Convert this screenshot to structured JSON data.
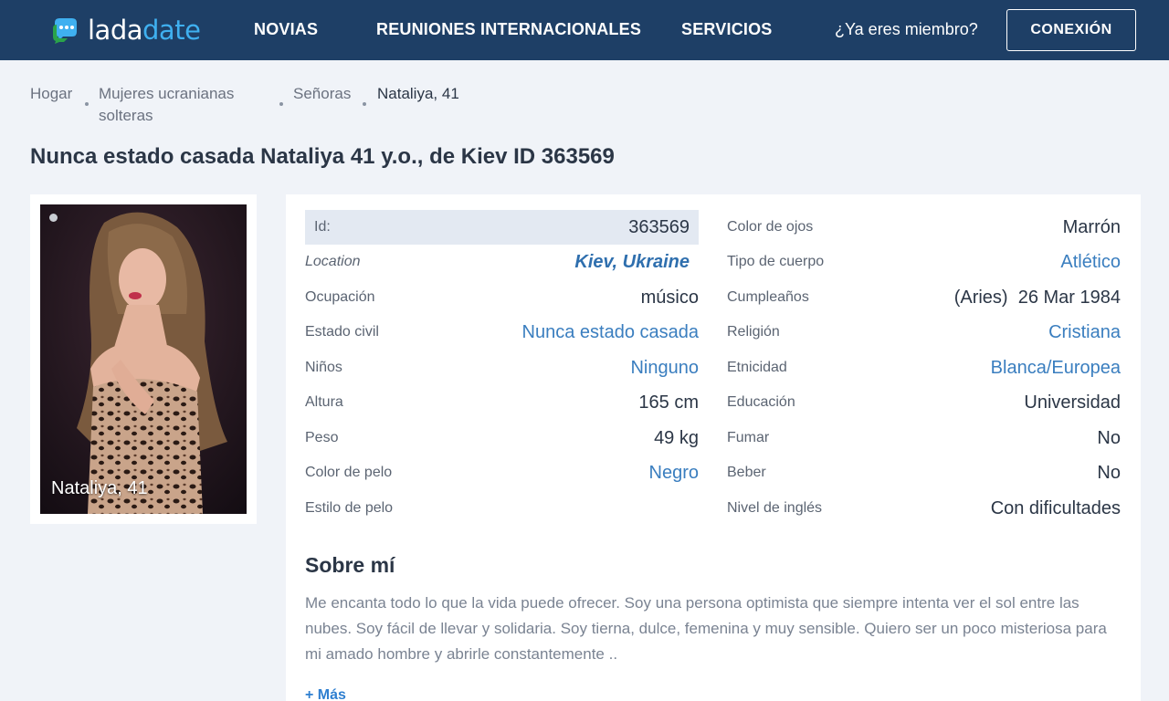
{
  "header": {
    "logo_part1": "lada",
    "logo_part2": "date",
    "nav": [
      "NOVIAS",
      "REUNIONES INTERNACIONALES",
      "SERVICIOS"
    ],
    "member_text": "¿Ya eres miembro?",
    "login_label": "CONEXIÓN"
  },
  "breadcrumb": {
    "items": [
      "Hogar",
      "Mujeres ucranianas",
      "solteras",
      "Señoras",
      "Nataliya, 41"
    ]
  },
  "page_title": "Nunca estado casada Nataliya 41 y.o., de Kiev ID 363569",
  "photo": {
    "caption": "Nataliya, 41"
  },
  "profile": {
    "left": [
      {
        "label": "Id:",
        "value": "363569"
      },
      {
        "label": "Location",
        "value": "Kiev, Ukraine"
      },
      {
        "label": "Ocupación",
        "value": "músico"
      },
      {
        "label": "Estado civil",
        "value": "Nunca estado casada"
      },
      {
        "label": "Niños",
        "value": "Ninguno"
      },
      {
        "label": "Altura",
        "value": "165 cm"
      },
      {
        "label": "Peso",
        "value": "49 kg"
      },
      {
        "label": "Color de pelo",
        "value": "Negro"
      },
      {
        "label": "Estilo de pelo",
        "value": ""
      }
    ],
    "right": [
      {
        "label": "Color de ojos",
        "value": "Marrón"
      },
      {
        "label": "Tipo de cuerpo",
        "value": "Atlético"
      },
      {
        "label": "Cumpleaños",
        "value": "(Aries)  26 Mar 1984"
      },
      {
        "label": "Religión",
        "value": "Cristiana"
      },
      {
        "label": "Etnicidad",
        "value": "Blanca/Europea"
      },
      {
        "label": "Educación",
        "value": "Universidad"
      },
      {
        "label": "Fumar",
        "value": "No"
      },
      {
        "label": "Beber",
        "value": "No"
      },
      {
        "label": "Nivel de inglés",
        "value": "Con dificultades"
      }
    ]
  },
  "about": {
    "title": "Sobre mí",
    "text": "Me encanta todo lo que la vida puede ofrecer. Soy una persona optimista que siempre intenta ver el sol entre las nubes. Soy fácil de llevar y solidaria. Soy tierna, dulce, femenina y muy sensible. Quiero ser un poco misteriosa para mi amado hombre y abrirle constantemente ..",
    "more_label": "+ Más"
  },
  "colors": {
    "header_bg": "#1e3f66",
    "accent": "#3fb0f0",
    "link": "#3a7ebf",
    "page_bg": "#f0f3f8"
  }
}
